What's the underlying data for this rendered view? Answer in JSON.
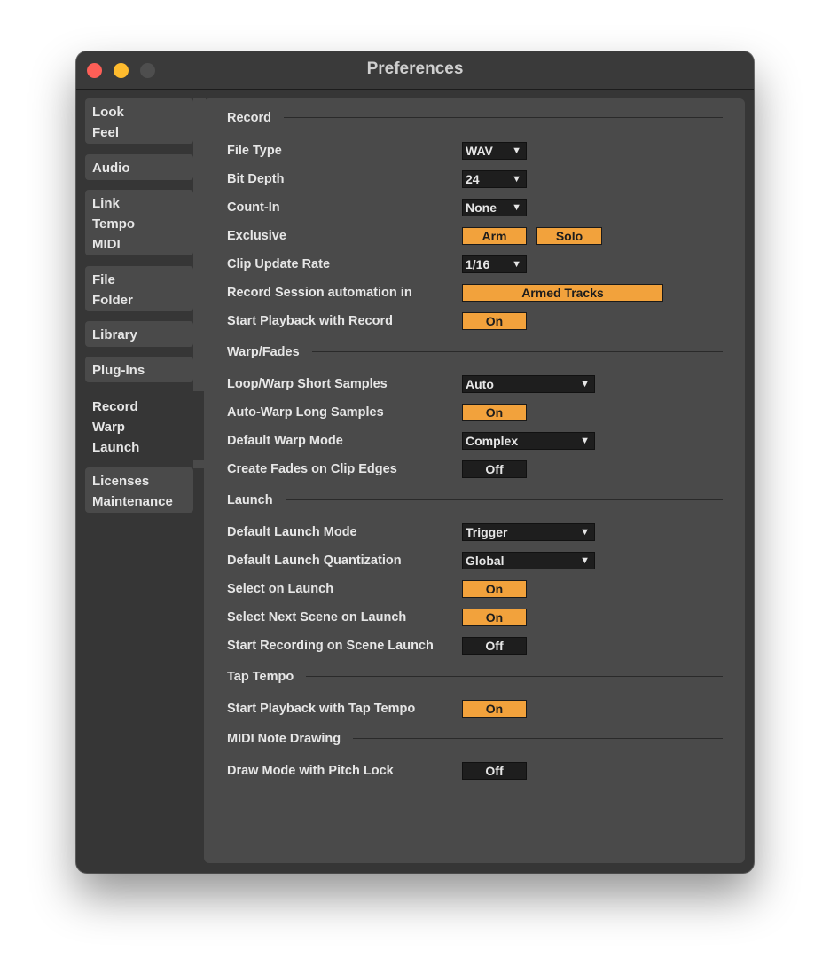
{
  "window": {
    "title": "Preferences"
  },
  "sidebar": {
    "tabs": [
      {
        "lines": [
          "Look",
          "Feel"
        ]
      },
      {
        "lines": [
          "Audio"
        ]
      },
      {
        "lines": [
          "Link",
          "Tempo",
          "MIDI"
        ]
      },
      {
        "lines": [
          "File",
          "Folder"
        ]
      },
      {
        "lines": [
          "Library"
        ]
      },
      {
        "lines": [
          "Plug-Ins"
        ]
      },
      {
        "lines": [
          "Record",
          "Warp",
          "Launch"
        ],
        "active": true
      },
      {
        "lines": [
          "Licenses",
          "Maintenance"
        ]
      }
    ]
  },
  "sections": {
    "record": {
      "title": "Record",
      "file_type": {
        "label": "File Type",
        "value": "WAV"
      },
      "bit_depth": {
        "label": "Bit Depth",
        "value": "24"
      },
      "count_in": {
        "label": "Count-In",
        "value": "None"
      },
      "exclusive": {
        "label": "Exclusive",
        "arm": "Arm",
        "solo": "Solo"
      },
      "clip_update_rate": {
        "label": "Clip Update Rate",
        "value": "1/16"
      },
      "session_automation": {
        "label": "Record Session automation in",
        "value": "Armed Tracks"
      },
      "start_playback": {
        "label": "Start Playback with Record",
        "value": "On"
      }
    },
    "warp": {
      "title": "Warp/Fades",
      "loop_warp": {
        "label": "Loop/Warp Short Samples",
        "value": "Auto"
      },
      "auto_warp": {
        "label": "Auto-Warp Long Samples",
        "value": "On"
      },
      "warp_mode": {
        "label": "Default Warp Mode",
        "value": "Complex"
      },
      "create_fades": {
        "label": "Create Fades on Clip Edges",
        "value": "Off"
      }
    },
    "launch": {
      "title": "Launch",
      "launch_mode": {
        "label": "Default Launch Mode",
        "value": "Trigger"
      },
      "launch_quant": {
        "label": "Default Launch Quantization",
        "value": "Global"
      },
      "select_on_launch": {
        "label": "Select on Launch",
        "value": "On"
      },
      "select_next_scene": {
        "label": "Select Next Scene on Launch",
        "value": "On"
      },
      "start_recording_scene": {
        "label": "Start Recording on Scene Launch",
        "value": "Off"
      }
    },
    "tap_tempo": {
      "title": "Tap Tempo",
      "start_playback_tap": {
        "label": "Start Playback with Tap Tempo",
        "value": "On"
      }
    },
    "midi_note": {
      "title": "MIDI Note Drawing",
      "draw_mode_pitch_lock": {
        "label": "Draw Mode with Pitch Lock",
        "value": "Off"
      }
    }
  },
  "icons": {
    "dropdown_arrow": "▼"
  },
  "colors": {
    "accent_on": "#f2a23c",
    "panel": "#4a4a4a",
    "window": "#363636",
    "close": "#fe5f57",
    "minimize": "#febb2e"
  }
}
